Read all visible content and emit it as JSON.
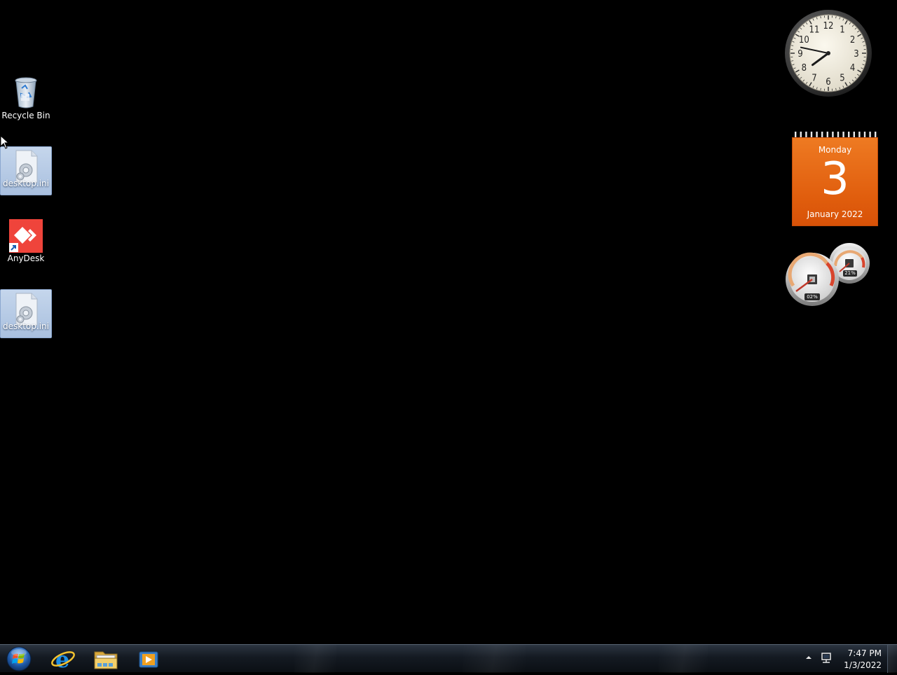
{
  "desktop": {
    "icons": [
      {
        "label": "Recycle Bin",
        "icon": "recycle-bin-icon"
      },
      {
        "label": "desktop.ini",
        "icon": "settings-file-icon"
      },
      {
        "label": "AnyDesk",
        "icon": "anydesk-icon"
      },
      {
        "label": "desktop.ini",
        "icon": "settings-file-icon"
      }
    ]
  },
  "gadgets": {
    "clock": {
      "time": "7:47",
      "numerals": [
        "12",
        "1",
        "2",
        "3",
        "4",
        "5",
        "6",
        "7",
        "8",
        "9",
        "10",
        "11"
      ]
    },
    "calendar": {
      "weekday": "Monday",
      "day": "3",
      "month_year": "January 2022"
    },
    "cpu_meter": {
      "cpu_percent": "02%",
      "memory_percent": "21%"
    }
  },
  "taskbar": {
    "buttons": [
      {
        "name": "start",
        "icon": "windows-logo-icon"
      },
      {
        "name": "internet-explorer",
        "icon": "internet-explorer-icon"
      },
      {
        "name": "windows-explorer",
        "icon": "folder-icon"
      },
      {
        "name": "media-player",
        "icon": "media-player-icon"
      }
    ],
    "tray": {
      "time": "7:47 PM",
      "date": "1/3/2022"
    }
  },
  "colors": {
    "desktop_background": "#000000",
    "calendar_orange": "#e8661a",
    "anydesk_red": "#ef443b"
  }
}
